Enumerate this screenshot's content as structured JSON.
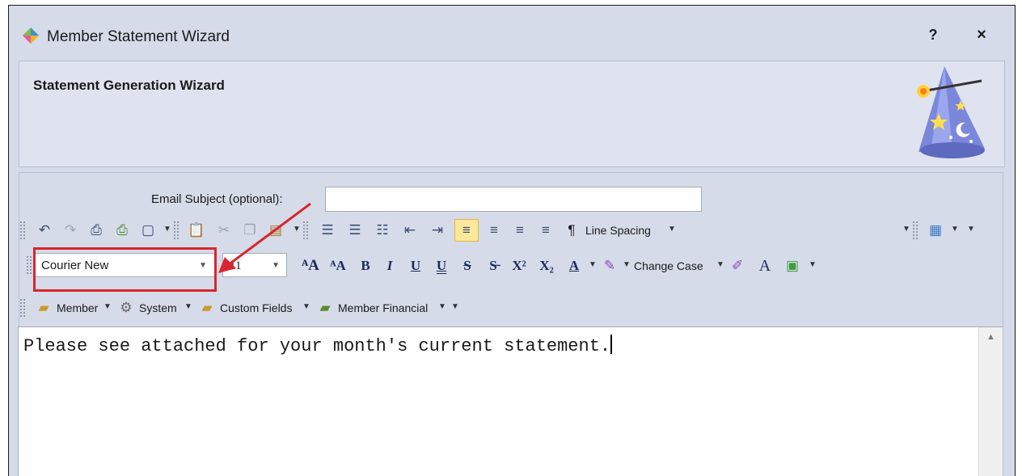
{
  "window": {
    "title": "Member Statement Wizard",
    "help_label": "?",
    "close_label": "×"
  },
  "header": {
    "title": "Statement Generation Wizard"
  },
  "subject": {
    "label": "Email Subject (optional):",
    "value": ""
  },
  "toolbar1": {
    "line_spacing": "Line Spacing"
  },
  "toolbar2": {
    "font_name": "Courier New",
    "font_size": "11",
    "change_case": "Change Case"
  },
  "toolbar3": {
    "member": "Member",
    "system": "System",
    "custom_fields": "Custom Fields",
    "member_financial": "Member Financial"
  },
  "editor": {
    "text": "Please see attached for your month's current statement."
  },
  "colors": {
    "highlight": "#d9262c",
    "active_align": "#fbe89b",
    "window_bg": "#d6dbe9"
  }
}
